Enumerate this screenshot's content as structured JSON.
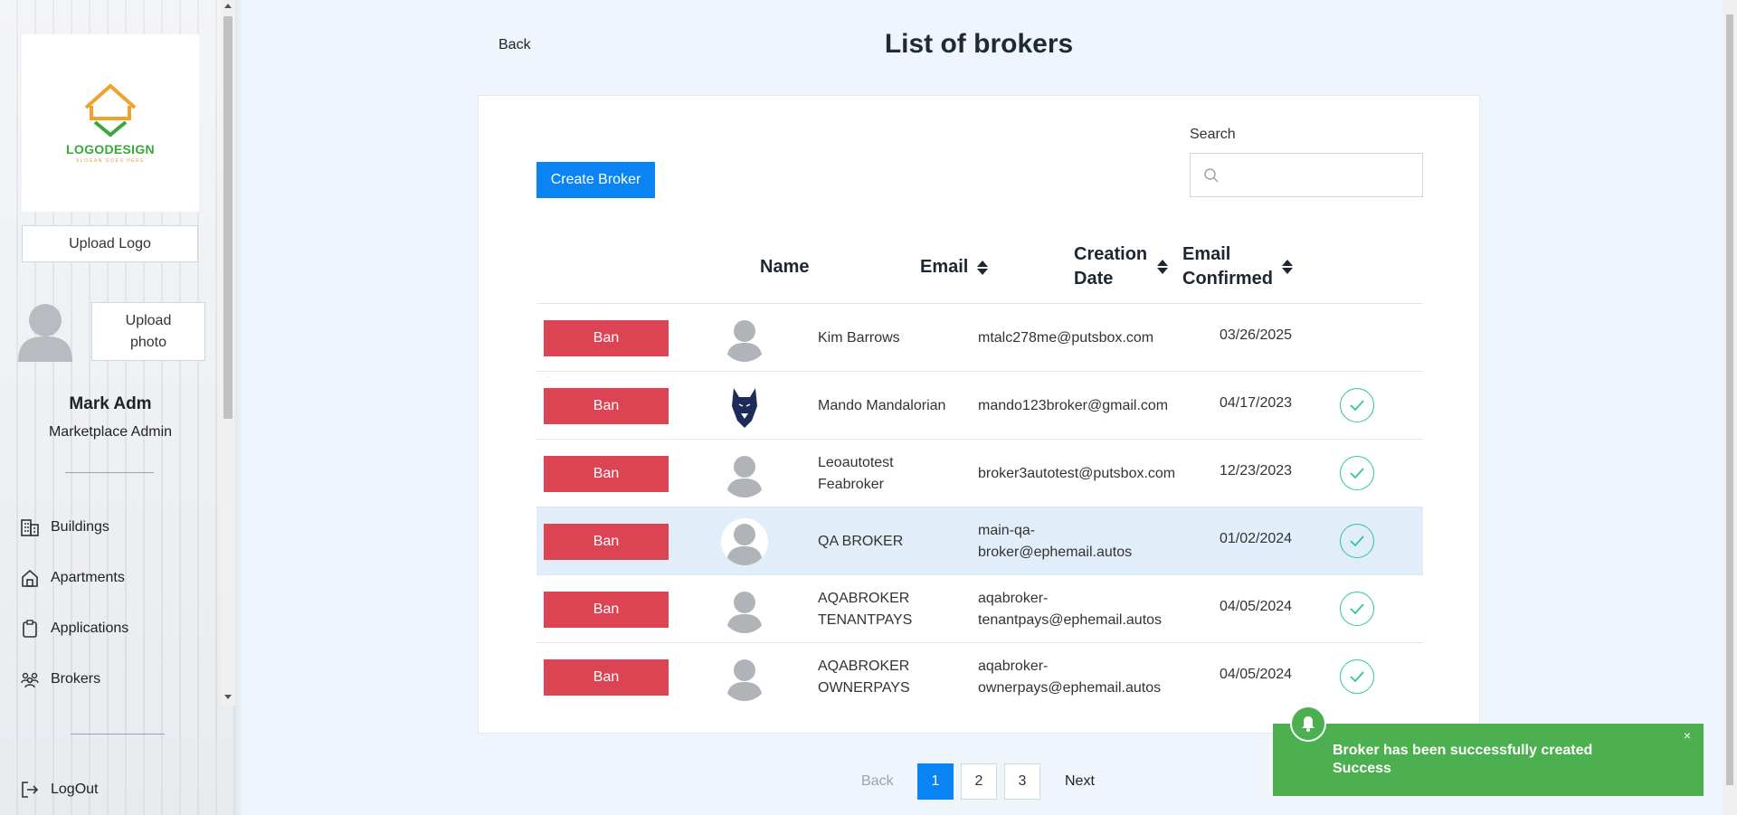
{
  "sidebar": {
    "logo": {
      "text": "LOGODESIGN",
      "slogan": "SLOGAN GOES HERE"
    },
    "upload_logo_label": "Upload Logo",
    "upload_photo_label": "Upload photo",
    "user": {
      "name": "Mark Adm",
      "role": "Marketplace Admin"
    },
    "nav": [
      {
        "label": "Buildings",
        "icon": "building-icon"
      },
      {
        "label": "Apartments",
        "icon": "home-icon"
      },
      {
        "label": "Applications",
        "icon": "clipboard-icon"
      },
      {
        "label": "Brokers",
        "icon": "people-icon"
      }
    ],
    "logout_label": "LogOut"
  },
  "header": {
    "back_label": "Back",
    "title": "List of brokers"
  },
  "toolbar": {
    "create_label": "Create Broker",
    "search_label": "Search",
    "search_placeholder": ""
  },
  "table": {
    "columns": {
      "name": "Name",
      "email": "Email",
      "creation_date": "Creation Date",
      "email_confirmed": "Email Confirmed"
    },
    "ban_label": "Ban",
    "rows": [
      {
        "name": "Kim Barrows",
        "email": "mtalc278me@putsbox.com",
        "date": "03/26/2025",
        "confirmed": false,
        "avatar": "default"
      },
      {
        "name": "Mando Mandalorian",
        "email": "mando123broker@gmail.com",
        "date": "04/17/2023",
        "confirmed": true,
        "avatar": "wolf"
      },
      {
        "name": "Leoautotest Feabroker",
        "email": "broker3autotest@putsbox.com",
        "date": "12/23/2023",
        "confirmed": true,
        "avatar": "default"
      },
      {
        "name": "QA BROKER",
        "email": "main-qa-broker@ephemail.autos",
        "date": "01/02/2024",
        "confirmed": true,
        "avatar": "default",
        "highlight": true
      },
      {
        "name": "AQABROKER TENANTPAYS",
        "email": "aqabroker-tenantpays@ephemail.autos",
        "date": "04/05/2024",
        "confirmed": true,
        "avatar": "default"
      },
      {
        "name": "AQABROKER OWNERPAYS",
        "email": "aqabroker-ownerpays@ephemail.autos",
        "date": "04/05/2024",
        "confirmed": true,
        "avatar": "default"
      }
    ]
  },
  "pagination": {
    "back_label": "Back",
    "pages": [
      "1",
      "2",
      "3"
    ],
    "current": "1",
    "next_label": "Next"
  },
  "toast": {
    "title": "Broker has been successfully created",
    "message": "Success",
    "close": "×"
  },
  "colors": {
    "primary": "#0b84f3",
    "danger": "#dc4454",
    "success": "#4caf50",
    "check": "#2ec4a0"
  }
}
